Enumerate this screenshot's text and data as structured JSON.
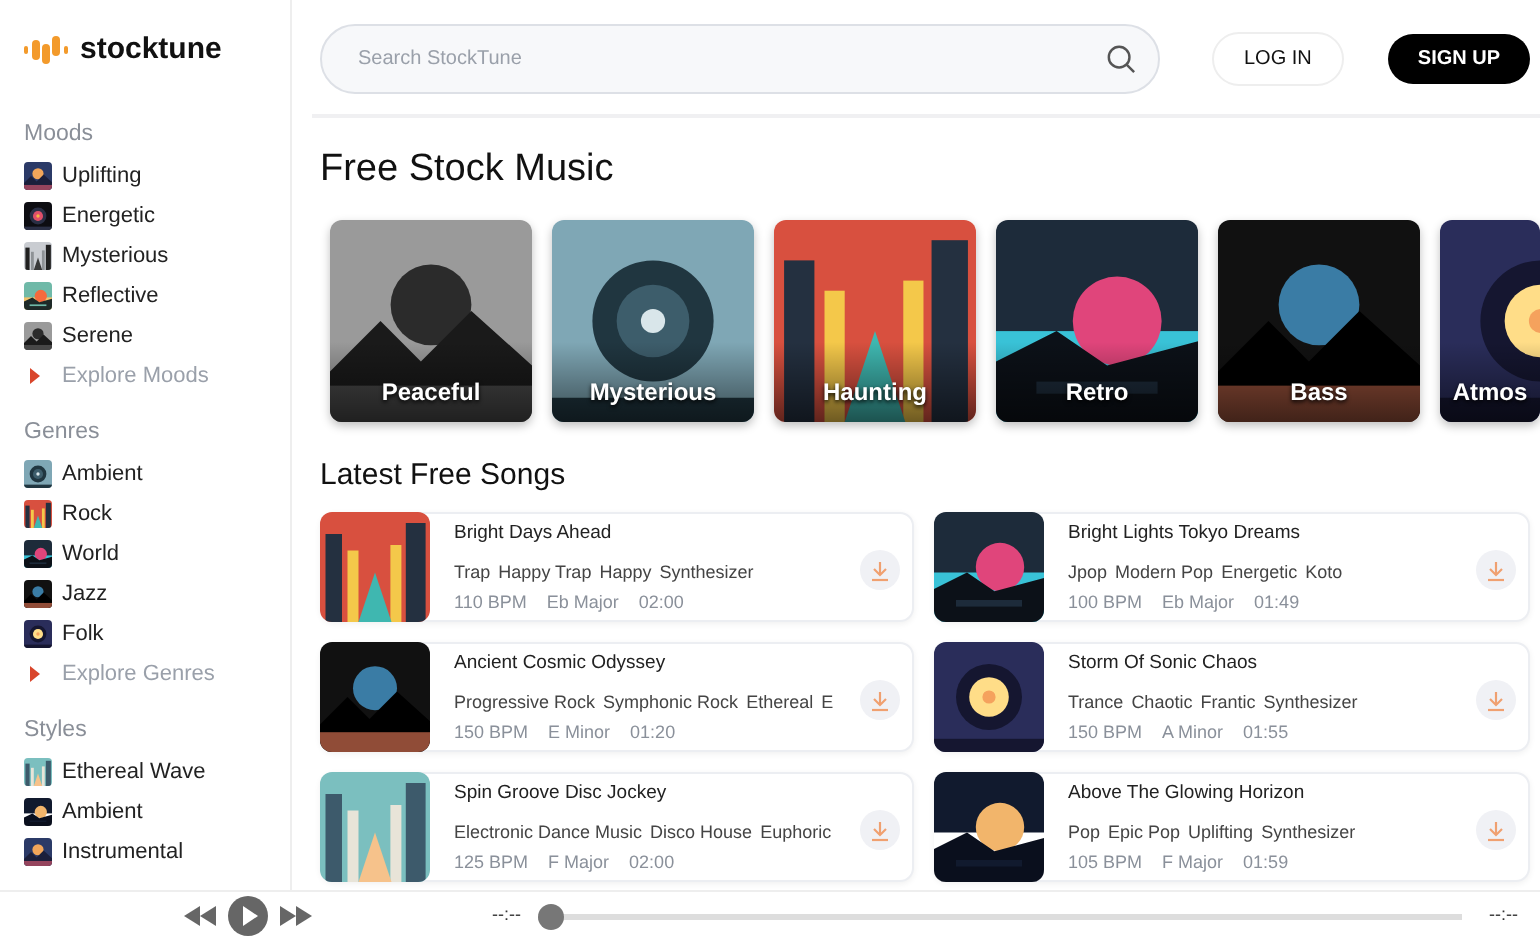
{
  "brand": {
    "name": "stocktune"
  },
  "sidebar": {
    "sections": [
      {
        "title": "Moods",
        "items": [
          {
            "label": "Uplifting"
          },
          {
            "label": "Energetic"
          },
          {
            "label": "Mysterious"
          },
          {
            "label": "Reflective"
          },
          {
            "label": "Serene"
          }
        ],
        "explore": "Explore Moods"
      },
      {
        "title": "Genres",
        "items": [
          {
            "label": "Ambient"
          },
          {
            "label": "Rock"
          },
          {
            "label": "World"
          },
          {
            "label": "Jazz"
          },
          {
            "label": "Folk"
          }
        ],
        "explore": "Explore Genres"
      },
      {
        "title": "Styles",
        "items": [
          {
            "label": "Ethereal Wave"
          },
          {
            "label": "Ambient"
          },
          {
            "label": "Instrumental"
          }
        ]
      }
    ]
  },
  "search": {
    "placeholder": "Search StockTune"
  },
  "auth": {
    "login": "LOG IN",
    "signup": "SIGN UP"
  },
  "featured": {
    "title": "Free Stock Music",
    "cards": [
      {
        "label": "Peaceful"
      },
      {
        "label": "Mysterious"
      },
      {
        "label": "Haunting"
      },
      {
        "label": "Retro"
      },
      {
        "label": "Bass"
      },
      {
        "label": "Atmos"
      }
    ]
  },
  "latest": {
    "title": "Latest Free Songs",
    "songs": [
      {
        "title": "Bright Days Ahead",
        "tags": [
          "Trap",
          "Happy Trap",
          "Happy",
          "Synthesizer"
        ],
        "bpm": "110 BPM",
        "key": "Eb Major",
        "duration": "02:00"
      },
      {
        "title": "Bright Lights Tokyo Dreams",
        "tags": [
          "Jpop",
          "Modern Pop",
          "Energetic",
          "Koto"
        ],
        "bpm": "100 BPM",
        "key": "Eb Major",
        "duration": "01:49"
      },
      {
        "title": "Ancient Cosmic Odyssey",
        "tags": [
          "Progressive Rock",
          "Symphonic Rock",
          "Ethereal",
          "E"
        ],
        "bpm": "150 BPM",
        "key": "E Minor",
        "duration": "01:20"
      },
      {
        "title": "Storm Of Sonic Chaos",
        "tags": [
          "Trance",
          "Chaotic",
          "Frantic",
          "Synthesizer"
        ],
        "bpm": "150 BPM",
        "key": "A Minor",
        "duration": "01:55"
      },
      {
        "title": "Spin Groove Disc Jockey",
        "tags": [
          "Electronic Dance Music",
          "Disco House",
          "Euphoric"
        ],
        "bpm": "125 BPM",
        "key": "F Major",
        "duration": "02:00"
      },
      {
        "title": "Above The Glowing Horizon",
        "tags": [
          "Pop",
          "Epic Pop",
          "Uplifting",
          "Synthesizer"
        ],
        "bpm": "105 BPM",
        "key": "F Major",
        "duration": "01:59"
      }
    ]
  },
  "player": {
    "elapsed": "--:--",
    "remaining": "--:--",
    "level": 0
  }
}
